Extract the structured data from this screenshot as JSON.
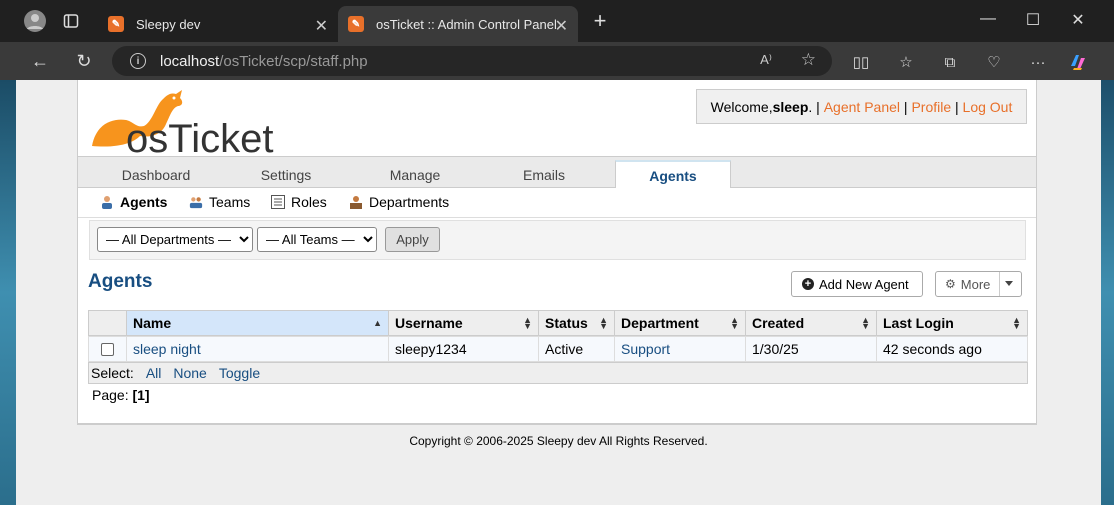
{
  "browser": {
    "tabs": [
      {
        "title": "Sleepy dev"
      },
      {
        "title": "osTicket :: Admin Control Panel"
      }
    ],
    "url_host": "localhost",
    "url_path": "/osTicket/scp/staff.php"
  },
  "header": {
    "logo_text": "osTicket",
    "welcome_prefix": "Welcome, ",
    "username": "sleep",
    "welcome_suffix": ". | ",
    "agent_panel": "Agent Panel",
    "sep1": " | ",
    "profile": "Profile",
    "sep2": " | ",
    "logout": "Log Out"
  },
  "nav": {
    "tabs": [
      {
        "label": "Dashboard"
      },
      {
        "label": "Settings"
      },
      {
        "label": "Manage"
      },
      {
        "label": "Emails"
      },
      {
        "label": "Agents"
      }
    ],
    "subtabs": [
      {
        "label": "Agents"
      },
      {
        "label": "Teams"
      },
      {
        "label": "Roles"
      },
      {
        "label": "Departments"
      }
    ]
  },
  "filters": {
    "department": "— All Departments —",
    "team": "— All Teams —",
    "apply": "Apply"
  },
  "main": {
    "title": "Agents",
    "add_button": "Add New Agent",
    "more_button": "More"
  },
  "table": {
    "columns": [
      "Name",
      "Username",
      "Status",
      "Department",
      "Created",
      "Last Login"
    ],
    "rows": [
      {
        "name": "sleep night",
        "username": "sleepy1234",
        "status": "Active",
        "department": "Support",
        "created": "1/30/25",
        "last_login": "42 seconds ago"
      }
    ],
    "select_label": "Select:",
    "select_all": "All",
    "select_none": "None",
    "select_toggle": "Toggle"
  },
  "pager": {
    "label": "Page:",
    "current": "[1]"
  },
  "footer": {
    "copyright": "Copyright © 2006-2025 Sleepy dev All Rights Reserved."
  },
  "colors": {
    "brand_orange": "#e8702a",
    "link_blue": "#184e81",
    "sorted_header": "#d4e6fa"
  }
}
